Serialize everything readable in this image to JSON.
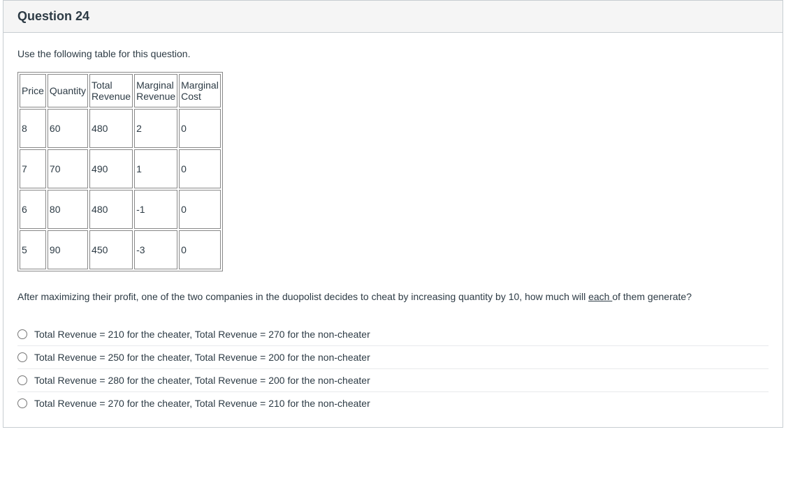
{
  "header": {
    "title": "Question 24"
  },
  "intro": "Use the following table for this question.",
  "table": {
    "headers": {
      "price": "Price",
      "quantity": "Quantity",
      "total_revenue_l1": "Total",
      "total_revenue_l2": "Revenue",
      "marginal_revenue_l1": "Marginal",
      "marginal_revenue_l2": "Revenue",
      "marginal_cost_l1": "Marginal",
      "marginal_cost_l2": "Cost"
    },
    "rows": [
      {
        "price": "8",
        "quantity": "60",
        "tr": "480",
        "mr": "2",
        "mc": "0"
      },
      {
        "price": "7",
        "quantity": "70",
        "tr": "490",
        "mr": "1",
        "mc": "0"
      },
      {
        "price": "6",
        "quantity": "80",
        "tr": "480",
        "mr": "-1",
        "mc": "0"
      },
      {
        "price": "5",
        "quantity": "90",
        "tr": "450",
        "mr": "-3",
        "mc": "0"
      }
    ]
  },
  "post_text_pre": "After maximizing their profit, one of the two companies in the duopolist decides to cheat by increasing quantity by 10, how much will ",
  "post_text_each": "each ",
  "post_text_post": "of them generate?",
  "options": [
    "Total Revenue = 210 for the cheater, Total Revenue = 270 for the non-cheater",
    "Total Revenue = 250 for the cheater, Total Revenue = 200 for the non-cheater",
    "Total Revenue = 280 for the cheater, Total Revenue = 200 for the non-cheater",
    "Total Revenue = 270 for the cheater, Total Revenue = 210 for the non-cheater"
  ]
}
